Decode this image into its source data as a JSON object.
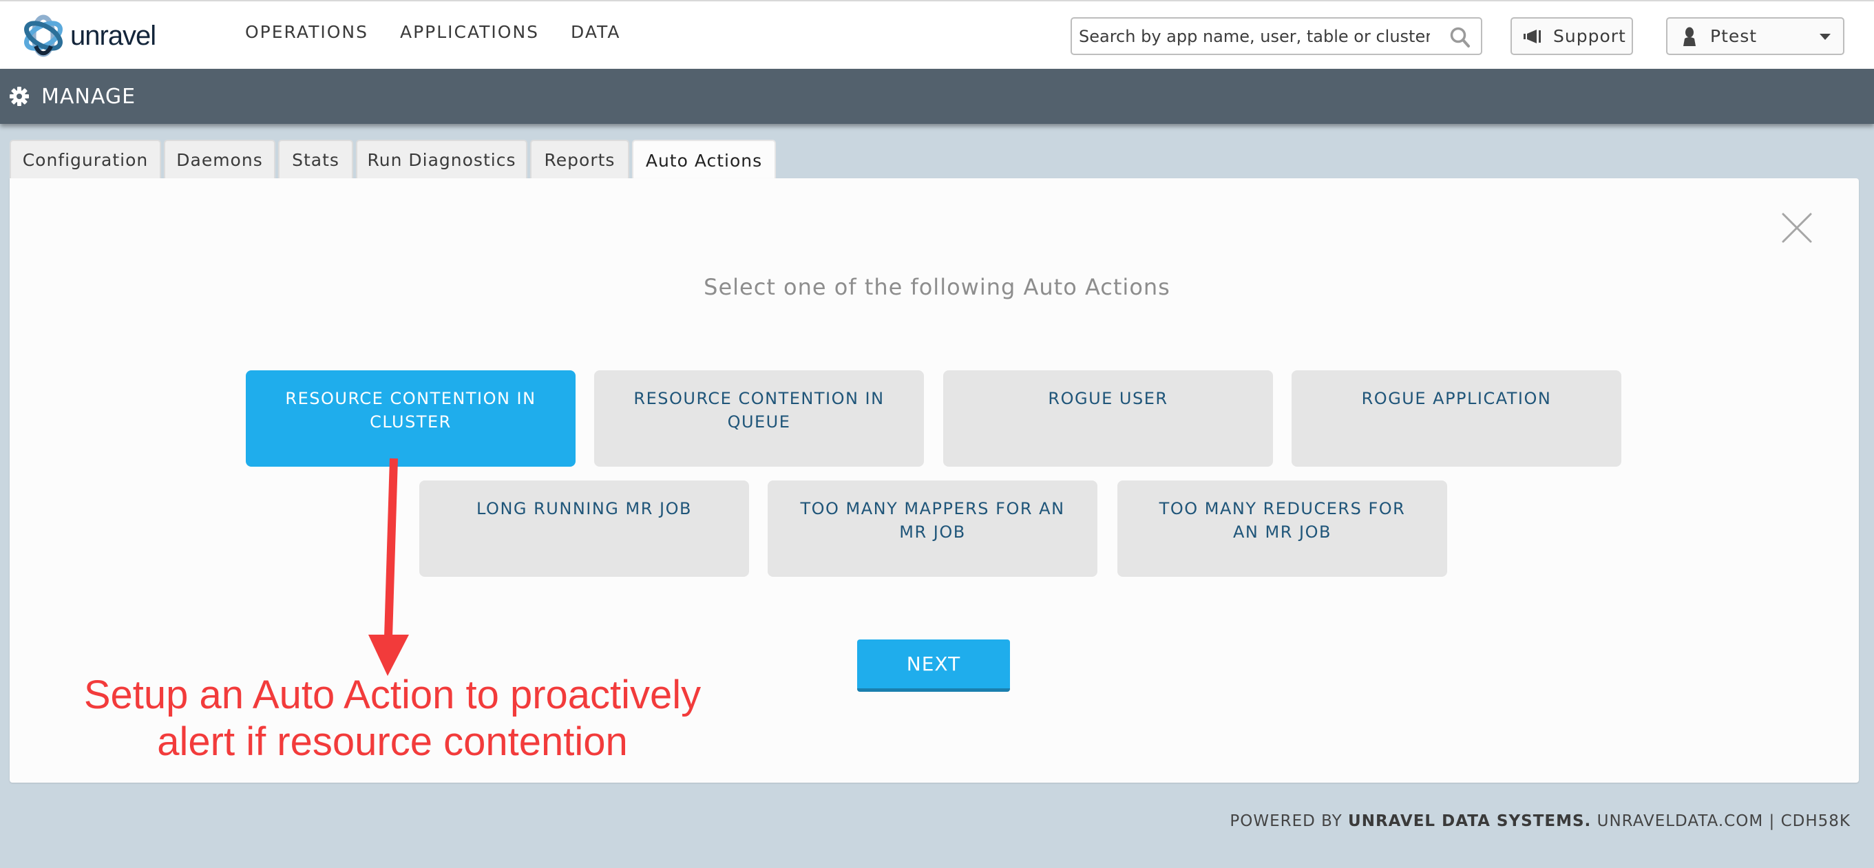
{
  "header": {
    "logo_text": "unravel",
    "nav": [
      "OPERATIONS",
      "APPLICATIONS",
      "DATA"
    ],
    "search": {
      "placeholder": "Search by app name, user, table or cluster",
      "value": "",
      "icon": "search-icon"
    },
    "support_label": "Support",
    "user_label": "Ptest"
  },
  "manage_bar": {
    "title": "MANAGE",
    "icon": "gear-icon"
  },
  "tabs": [
    {
      "label": "Configuration",
      "active": false
    },
    {
      "label": "Daemons",
      "active": false
    },
    {
      "label": "Stats",
      "active": false
    },
    {
      "label": "Run Diagnostics",
      "active": false
    },
    {
      "label": "Reports",
      "active": false
    },
    {
      "label": "Auto Actions",
      "active": true
    }
  ],
  "panel": {
    "title": "Select one of the following Auto Actions",
    "actions": [
      {
        "label": "RESOURCE CONTENTION IN CLUSTER",
        "selected": true
      },
      {
        "label": "RESOURCE CONTENTION IN QUEUE",
        "selected": false
      },
      {
        "label": "ROGUE USER",
        "selected": false
      },
      {
        "label": "ROGUE APPLICATION",
        "selected": false
      },
      {
        "label": "LONG RUNNING MR JOB",
        "selected": false
      },
      {
        "label": "TOO MANY MAPPERS FOR AN MR JOB",
        "selected": false
      },
      {
        "label": "TOO MANY REDUCERS FOR AN MR JOB",
        "selected": false
      }
    ],
    "next_label": "NEXT"
  },
  "annotation": {
    "line1": "Setup an Auto Action to proactively",
    "line2": "alert if resource contention",
    "color": "#f23b3b"
  },
  "footer": {
    "prefix": "POWERED BY ",
    "company": "UNRAVEL DATA SYSTEMS.",
    "suffix": " UNRAVELDATA.COM | CDH58K"
  },
  "colors": {
    "accent": "#1fadec",
    "manage_bar": "#53616d",
    "background": "#c9d6df",
    "action_text": "#1f5579"
  }
}
